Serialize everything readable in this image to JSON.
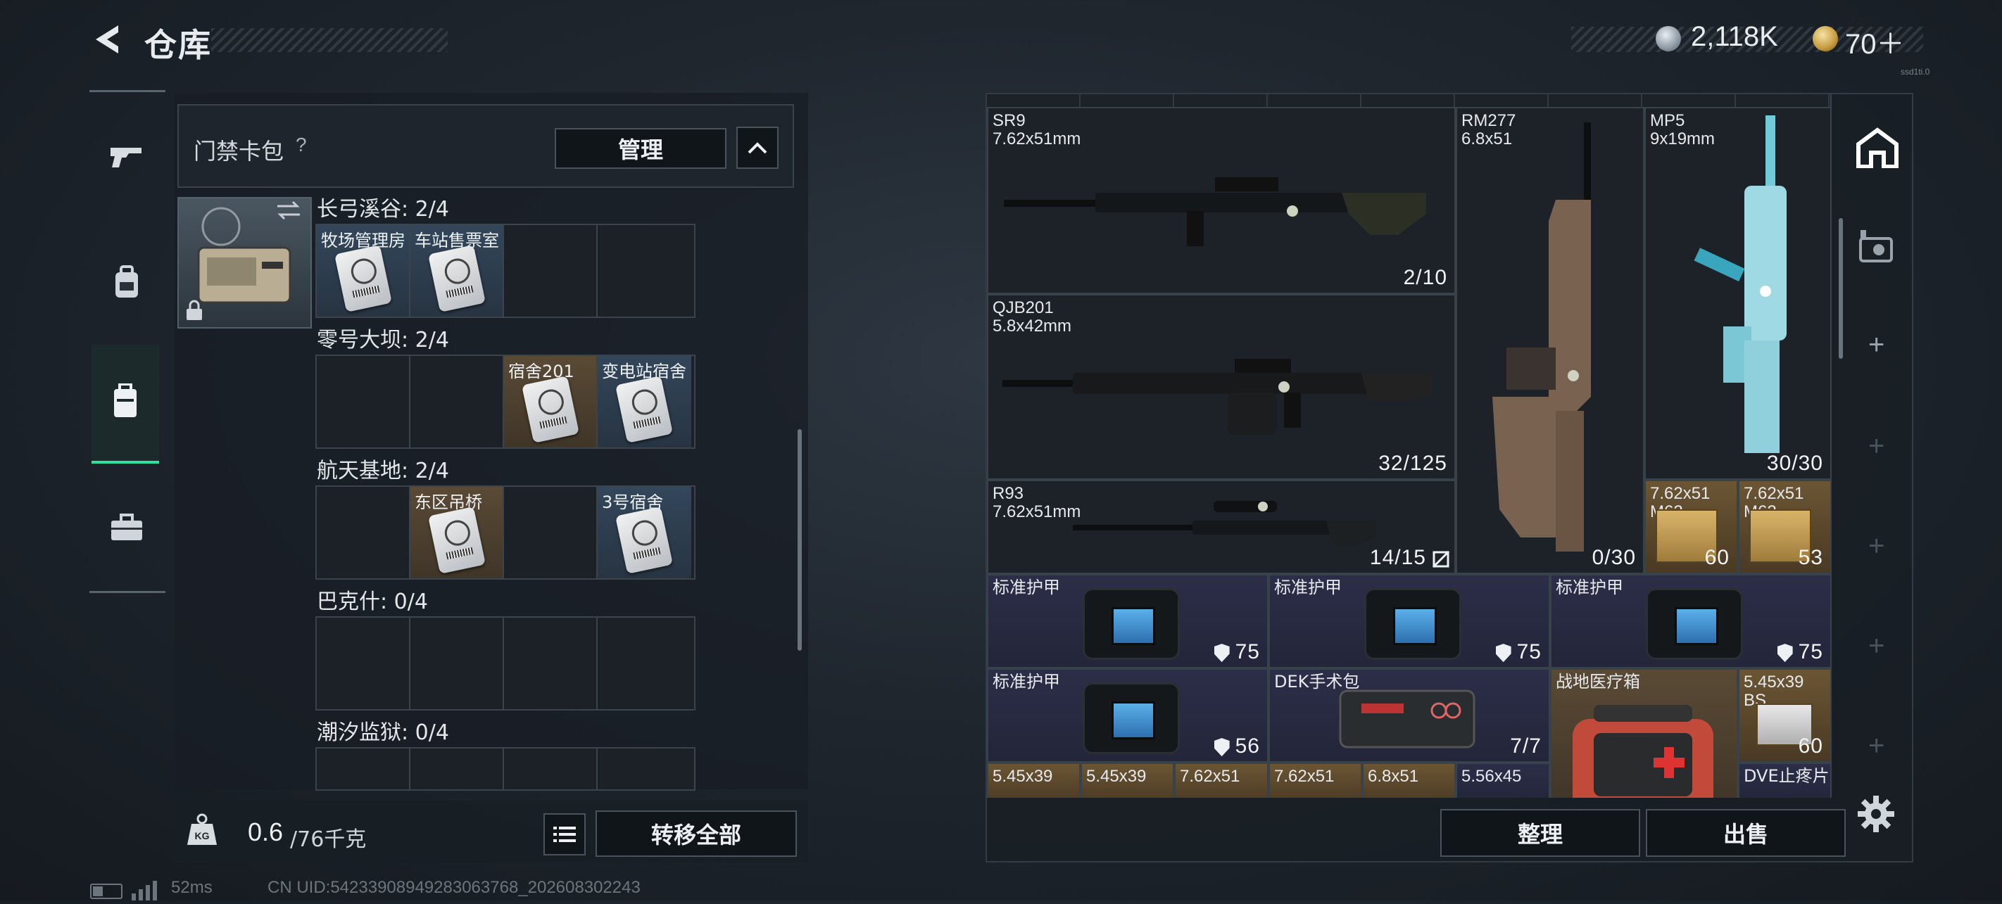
{
  "header": {
    "title": "仓库",
    "back_icon": "back-arrow-icon"
  },
  "currency": {
    "silver": "2,118K",
    "gold": "70＋"
  },
  "version": "ssd1ti.0",
  "left_rail": {
    "tabs": [
      "weapon-icon",
      "backpack-icon",
      "case-icon",
      "briefcase-icon"
    ],
    "active": "case-icon"
  },
  "keycard_pack": {
    "title": "门禁卡包",
    "help": "?",
    "manage_label": "管理",
    "regions": [
      {
        "label": "长弓溪谷: 2/4",
        "slots": [
          {
            "name": "牧场管理房",
            "color": "blue"
          },
          {
            "name": "车站售票室",
            "color": "blue"
          },
          {
            "name": "",
            "color": ""
          },
          {
            "name": "",
            "color": ""
          }
        ]
      },
      {
        "label": "零号大坝: 2/4",
        "slots": [
          {
            "name": "",
            "color": ""
          },
          {
            "name": "",
            "color": ""
          },
          {
            "name": "宿舍201",
            "color": "blue"
          },
          {
            "name": "变电站宿舍",
            "color": "blue"
          }
        ]
      },
      {
        "label": "航天基地: 2/4",
        "slots": [
          {
            "name": "",
            "color": ""
          },
          {
            "name": "东区吊桥",
            "color": "gold"
          },
          {
            "name": "",
            "color": ""
          },
          {
            "name": "3号宿舍",
            "color": "blue"
          }
        ]
      },
      {
        "label": "巴克什: 0/4",
        "slots": [
          {
            "name": "",
            "color": ""
          },
          {
            "name": "",
            "color": ""
          },
          {
            "name": "",
            "color": ""
          },
          {
            "name": "",
            "color": ""
          }
        ]
      },
      {
        "label": "潮汐监狱: 0/4",
        "slots": [
          {
            "name": "",
            "color": ""
          },
          {
            "name": "",
            "color": ""
          },
          {
            "name": "",
            "color": ""
          },
          {
            "name": "",
            "color": ""
          }
        ]
      }
    ]
  },
  "weight": {
    "value": "0.6",
    "max": "/76千克",
    "icon_label": "KG"
  },
  "transfer_all_label": "转移全部",
  "status": {
    "ping": "52ms",
    "uid": "CN UID:5423390894928306​3768_202608302243"
  },
  "warehouse": {
    "items": [
      {
        "name": "SR9",
        "caliber": "7.62x51mm",
        "qty": "2/10"
      },
      {
        "name": "QJB201",
        "caliber": "5.8x42mm",
        "qty": "32/125"
      },
      {
        "name": "R93",
        "caliber": "7.62x51mm",
        "qty": "14/15"
      },
      {
        "name": "RM277",
        "caliber": "6.8x51",
        "qty": "0/30"
      },
      {
        "name": "MP5",
        "caliber": "9x19mm",
        "qty": "30/30"
      },
      {
        "name": "7.62x51",
        "caliber": "M62",
        "qty": "60"
      },
      {
        "name": "7.62x51",
        "caliber": "M62",
        "qty": "53"
      },
      {
        "name": "标准护甲",
        "qty": "75"
      },
      {
        "name": "标准护甲",
        "qty": "75"
      },
      {
        "name": "标准护甲",
        "qty": "75"
      },
      {
        "name": "标准护甲",
        "qty": "56"
      },
      {
        "name": "DEK手术包",
        "qty": "7/7"
      },
      {
        "name": "战地医疗箱",
        "qty": ""
      },
      {
        "name": "5.45x39",
        "caliber": "BS",
        "qty": "60"
      }
    ],
    "bottom_row": [
      "5.45x39",
      "5.45x39",
      "7.62x51",
      "7.62x51",
      "6.8x51",
      "5.56x45",
      "DVE止疼片"
    ],
    "sort_label": "整理",
    "sell_label": "出售"
  }
}
